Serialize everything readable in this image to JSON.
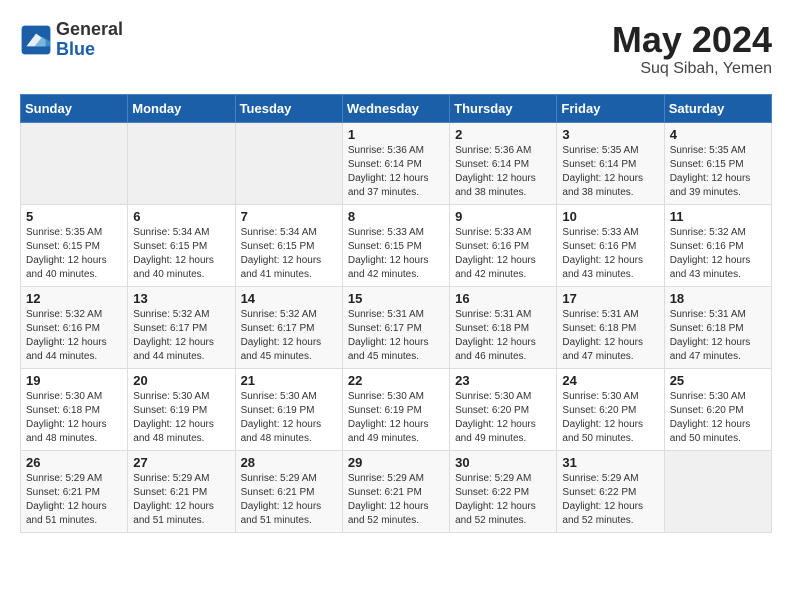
{
  "header": {
    "logo_general": "General",
    "logo_blue": "Blue",
    "title": "May 2024",
    "subtitle": "Suq Sibah, Yemen"
  },
  "weekdays": [
    "Sunday",
    "Monday",
    "Tuesday",
    "Wednesday",
    "Thursday",
    "Friday",
    "Saturday"
  ],
  "weeks": [
    [
      {
        "day": "",
        "empty": true
      },
      {
        "day": "",
        "empty": true
      },
      {
        "day": "",
        "empty": true
      },
      {
        "day": "1",
        "sunrise": "5:36 AM",
        "sunset": "6:14 PM",
        "daylight": "12 hours and 37 minutes."
      },
      {
        "day": "2",
        "sunrise": "5:36 AM",
        "sunset": "6:14 PM",
        "daylight": "12 hours and 38 minutes."
      },
      {
        "day": "3",
        "sunrise": "5:35 AM",
        "sunset": "6:14 PM",
        "daylight": "12 hours and 38 minutes."
      },
      {
        "day": "4",
        "sunrise": "5:35 AM",
        "sunset": "6:15 PM",
        "daylight": "12 hours and 39 minutes."
      }
    ],
    [
      {
        "day": "5",
        "sunrise": "5:35 AM",
        "sunset": "6:15 PM",
        "daylight": "12 hours and 40 minutes."
      },
      {
        "day": "6",
        "sunrise": "5:34 AM",
        "sunset": "6:15 PM",
        "daylight": "12 hours and 40 minutes."
      },
      {
        "day": "7",
        "sunrise": "5:34 AM",
        "sunset": "6:15 PM",
        "daylight": "12 hours and 41 minutes."
      },
      {
        "day": "8",
        "sunrise": "5:33 AM",
        "sunset": "6:15 PM",
        "daylight": "12 hours and 42 minutes."
      },
      {
        "day": "9",
        "sunrise": "5:33 AM",
        "sunset": "6:16 PM",
        "daylight": "12 hours and 42 minutes."
      },
      {
        "day": "10",
        "sunrise": "5:33 AM",
        "sunset": "6:16 PM",
        "daylight": "12 hours and 43 minutes."
      },
      {
        "day": "11",
        "sunrise": "5:32 AM",
        "sunset": "6:16 PM",
        "daylight": "12 hours and 43 minutes."
      }
    ],
    [
      {
        "day": "12",
        "sunrise": "5:32 AM",
        "sunset": "6:16 PM",
        "daylight": "12 hours and 44 minutes."
      },
      {
        "day": "13",
        "sunrise": "5:32 AM",
        "sunset": "6:17 PM",
        "daylight": "12 hours and 44 minutes."
      },
      {
        "day": "14",
        "sunrise": "5:32 AM",
        "sunset": "6:17 PM",
        "daylight": "12 hours and 45 minutes."
      },
      {
        "day": "15",
        "sunrise": "5:31 AM",
        "sunset": "6:17 PM",
        "daylight": "12 hours and 45 minutes."
      },
      {
        "day": "16",
        "sunrise": "5:31 AM",
        "sunset": "6:18 PM",
        "daylight": "12 hours and 46 minutes."
      },
      {
        "day": "17",
        "sunrise": "5:31 AM",
        "sunset": "6:18 PM",
        "daylight": "12 hours and 47 minutes."
      },
      {
        "day": "18",
        "sunrise": "5:31 AM",
        "sunset": "6:18 PM",
        "daylight": "12 hours and 47 minutes."
      }
    ],
    [
      {
        "day": "19",
        "sunrise": "5:30 AM",
        "sunset": "6:18 PM",
        "daylight": "12 hours and 48 minutes."
      },
      {
        "day": "20",
        "sunrise": "5:30 AM",
        "sunset": "6:19 PM",
        "daylight": "12 hours and 48 minutes."
      },
      {
        "day": "21",
        "sunrise": "5:30 AM",
        "sunset": "6:19 PM",
        "daylight": "12 hours and 48 minutes."
      },
      {
        "day": "22",
        "sunrise": "5:30 AM",
        "sunset": "6:19 PM",
        "daylight": "12 hours and 49 minutes."
      },
      {
        "day": "23",
        "sunrise": "5:30 AM",
        "sunset": "6:20 PM",
        "daylight": "12 hours and 49 minutes."
      },
      {
        "day": "24",
        "sunrise": "5:30 AM",
        "sunset": "6:20 PM",
        "daylight": "12 hours and 50 minutes."
      },
      {
        "day": "25",
        "sunrise": "5:30 AM",
        "sunset": "6:20 PM",
        "daylight": "12 hours and 50 minutes."
      }
    ],
    [
      {
        "day": "26",
        "sunrise": "5:29 AM",
        "sunset": "6:21 PM",
        "daylight": "12 hours and 51 minutes."
      },
      {
        "day": "27",
        "sunrise": "5:29 AM",
        "sunset": "6:21 PM",
        "daylight": "12 hours and 51 minutes."
      },
      {
        "day": "28",
        "sunrise": "5:29 AM",
        "sunset": "6:21 PM",
        "daylight": "12 hours and 51 minutes."
      },
      {
        "day": "29",
        "sunrise": "5:29 AM",
        "sunset": "6:21 PM",
        "daylight": "12 hours and 52 minutes."
      },
      {
        "day": "30",
        "sunrise": "5:29 AM",
        "sunset": "6:22 PM",
        "daylight": "12 hours and 52 minutes."
      },
      {
        "day": "31",
        "sunrise": "5:29 AM",
        "sunset": "6:22 PM",
        "daylight": "12 hours and 52 minutes."
      },
      {
        "day": "",
        "empty": true
      }
    ]
  ]
}
